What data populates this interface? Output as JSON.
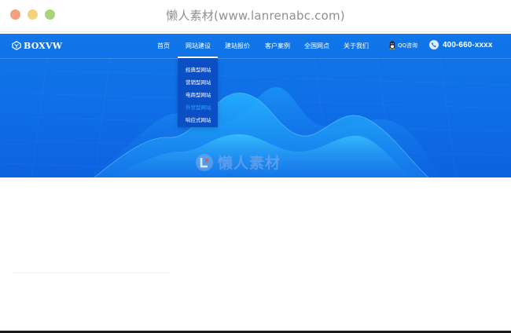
{
  "browser": {
    "title": "懒人素材(www.lanrenabc.com)"
  },
  "header": {
    "logo_text": "BOXVW",
    "nav": [
      {
        "label": "首页"
      },
      {
        "label": "网站建设"
      },
      {
        "label": "建站报价"
      },
      {
        "label": "客户案例"
      },
      {
        "label": "全国网点"
      },
      {
        "label": "关于我们"
      }
    ],
    "active_nav": "网站建设",
    "qq_label": "QQ咨询",
    "phone": "400-660-xxxx"
  },
  "dropdown": {
    "items": [
      {
        "label": "经典型网站"
      },
      {
        "label": "营销型网站"
      },
      {
        "label": "电商型网站"
      },
      {
        "label": "外贸型网站"
      },
      {
        "label": "响应式网站"
      }
    ],
    "hovered": "外贸型网站"
  },
  "hero": {
    "watermark_text": "懒人素材"
  },
  "colors": {
    "nav_bg": "#0f6fe8",
    "dropdown_bg": "#0b4fc4",
    "dropdown_hover": "#2fa8ff"
  }
}
